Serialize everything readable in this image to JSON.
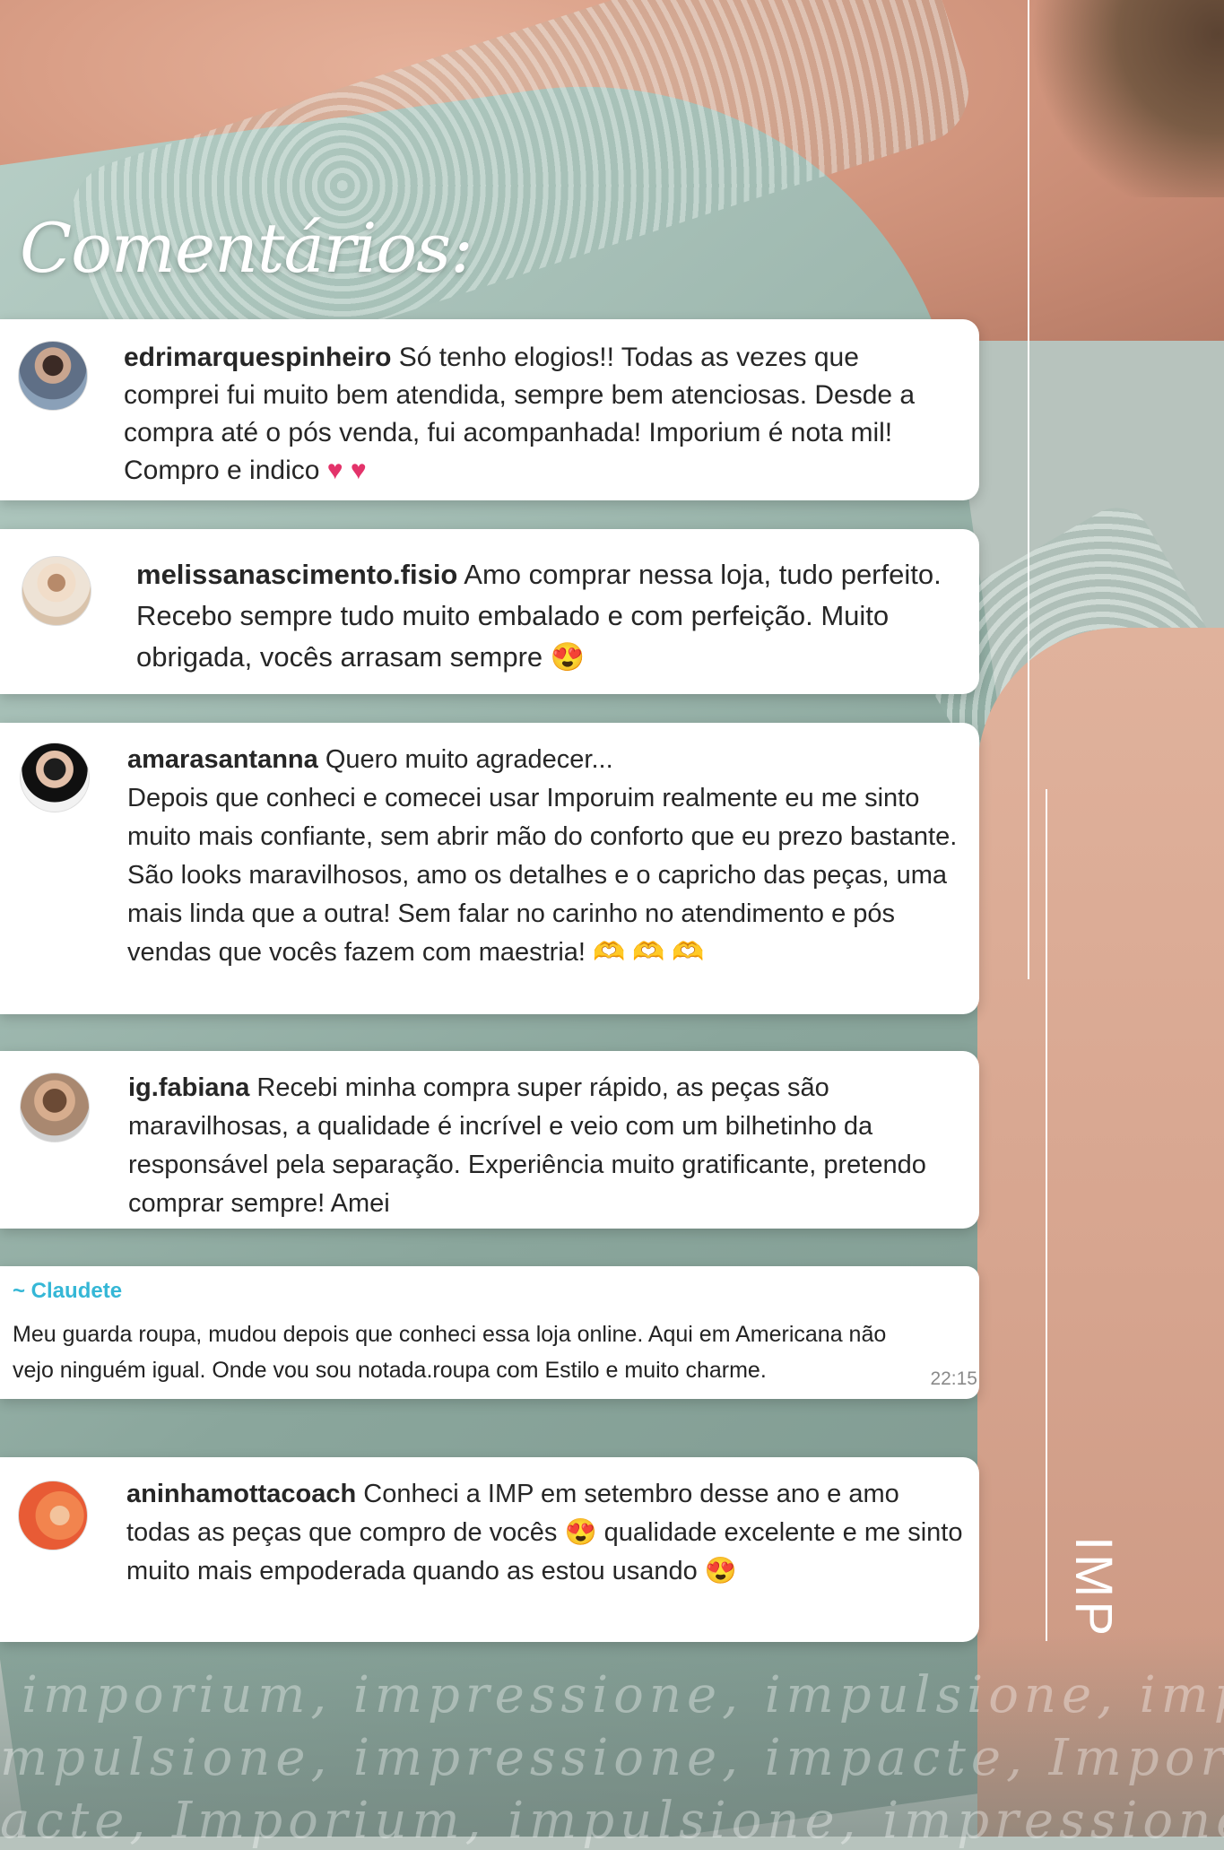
{
  "heading": "Comentários:",
  "comments": [
    {
      "username": "edrimarquespinheiro",
      "text": "Só tenho elogios!! Todas as vezes que comprei fui muito bem atendida, sempre bem atenciosas. Desde a compra até o pós venda, fui acompanhada! Imporium é nota mil! Compro e indico",
      "emoji": "♥ ♥"
    },
    {
      "username": "melissanascimento.fisio",
      "text": "Amo comprar nessa loja, tudo perfeito. Recebo sempre tudo muito embalado e com perfeição. Muito obrigada, vocês arrasam sempre",
      "emoji": "😍"
    },
    {
      "username": "amarasantanna",
      "text_first": "Quero muito agradecer...",
      "text": "Depois que conheci e comecei usar Imporuim realmente eu me sinto muito mais confiante, sem abrir mão do conforto que eu prezo bastante. São looks maravilhosos, amo os detalhes e o capricho das peças, uma mais linda que a outra! Sem falar no carinho no atendimento e pós vendas que vocês fazem com maestria!",
      "emoji": "🫶 🫶 🫶"
    },
    {
      "username": "ig.fabiana",
      "text": "Recebi minha compra super rápido, as peças são maravilhosas, a qualidade é incrível e veio com um bilhetinho da responsável pela separação. Experiência muito gratificante, pretendo comprar sempre! Amei"
    },
    {
      "username": "aninhamottacoach",
      "text_a": "Conheci a IMP em setembro desse ano e amo todas as peças que compro de vocês",
      "emoji_a": "😍",
      "text_b": "qualidade excelente e me sinto muito mais empoderada quando as estou usando",
      "emoji_b": "😍"
    }
  ],
  "whatsapp": {
    "sender": "~ Claudete",
    "message": "Meu guarda roupa, mudou depois que conheci essa loja online. Aqui em Americana não vejo ninguém igual. Onde vou sou notada.roupa com Estilo e muito charme.",
    "time": "22:15"
  },
  "brand": "IMP",
  "taglines": [
    "imporium, impressione, impulsione, impac",
    "mpulsione, impressione, impacte, Imporium",
    "acte, Imporium, impulsione, impressione, I"
  ]
}
